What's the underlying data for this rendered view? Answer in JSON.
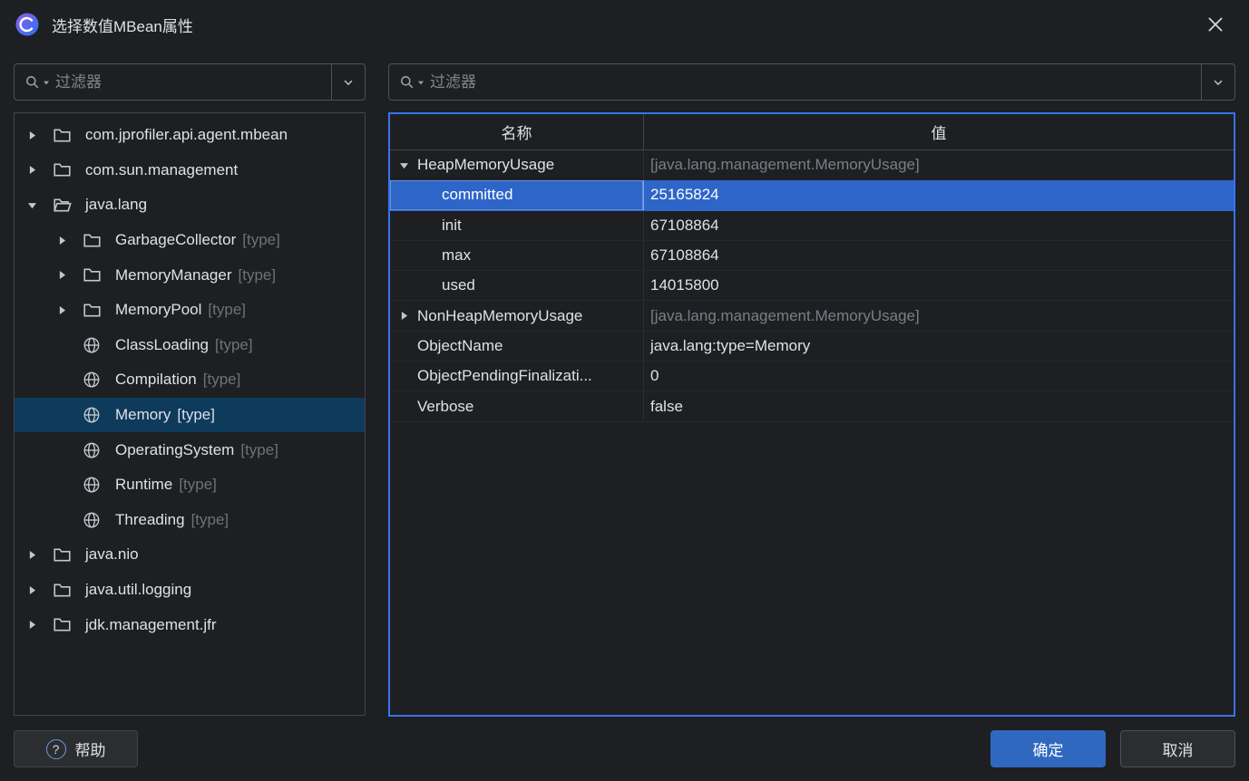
{
  "titlebar": {
    "title": "选择数值MBean属性"
  },
  "left": {
    "filter_placeholder": "过滤器",
    "tree": [
      {
        "label": "com.jprofiler.api.agent.mbean",
        "suffix": "",
        "icon": "folder",
        "expand": "collapsed",
        "level": 0,
        "selected": false
      },
      {
        "label": "com.sun.management",
        "suffix": "",
        "icon": "folder",
        "expand": "collapsed",
        "level": 0,
        "selected": false
      },
      {
        "label": "java.lang",
        "suffix": "",
        "icon": "folder-open",
        "expand": "expanded",
        "level": 0,
        "selected": false
      },
      {
        "label": "GarbageCollector",
        "suffix": "[type]",
        "icon": "folder",
        "expand": "collapsed",
        "level": 1,
        "selected": false
      },
      {
        "label": "MemoryManager",
        "suffix": "[type]",
        "icon": "folder",
        "expand": "collapsed",
        "level": 1,
        "selected": false
      },
      {
        "label": "MemoryPool",
        "suffix": "[type]",
        "icon": "folder",
        "expand": "collapsed",
        "level": 1,
        "selected": false
      },
      {
        "label": "ClassLoading",
        "suffix": "[type]",
        "icon": "globe",
        "expand": "none",
        "level": 1,
        "selected": false
      },
      {
        "label": "Compilation",
        "suffix": "[type]",
        "icon": "globe",
        "expand": "none",
        "level": 1,
        "selected": false
      },
      {
        "label": "Memory",
        "suffix": "[type]",
        "icon": "globe",
        "expand": "none",
        "level": 1,
        "selected": true
      },
      {
        "label": "OperatingSystem",
        "suffix": "[type]",
        "icon": "globe",
        "expand": "none",
        "level": 1,
        "selected": false
      },
      {
        "label": "Runtime",
        "suffix": "[type]",
        "icon": "globe",
        "expand": "none",
        "level": 1,
        "selected": false
      },
      {
        "label": "Threading",
        "suffix": "[type]",
        "icon": "globe",
        "expand": "none",
        "level": 1,
        "selected": false
      },
      {
        "label": "java.nio",
        "suffix": "",
        "icon": "folder",
        "expand": "collapsed",
        "level": 0,
        "selected": false
      },
      {
        "label": "java.util.logging",
        "suffix": "",
        "icon": "folder",
        "expand": "collapsed",
        "level": 0,
        "selected": false
      },
      {
        "label": "jdk.management.jfr",
        "suffix": "",
        "icon": "folder",
        "expand": "collapsed",
        "level": 0,
        "selected": false
      }
    ]
  },
  "right": {
    "filter_placeholder": "过滤器",
    "table": {
      "columns": [
        "名称",
        "值"
      ],
      "rows": [
        {
          "name": "HeapMemoryUsage",
          "value": "[java.lang.management.MemoryUsage]",
          "expand": "expanded",
          "level": 0,
          "muted": true,
          "selected": false
        },
        {
          "name": "committed",
          "value": "25165824",
          "expand": "none",
          "level": 1,
          "muted": false,
          "selected": true
        },
        {
          "name": "init",
          "value": "67108864",
          "expand": "none",
          "level": 1,
          "muted": false,
          "selected": false
        },
        {
          "name": "max",
          "value": "67108864",
          "expand": "none",
          "level": 1,
          "muted": false,
          "selected": false
        },
        {
          "name": "used",
          "value": "14015800",
          "expand": "none",
          "level": 1,
          "muted": false,
          "selected": false
        },
        {
          "name": "NonHeapMemoryUsage",
          "value": "[java.lang.management.MemoryUsage]",
          "expand": "collapsed",
          "level": 0,
          "muted": true,
          "selected": false
        },
        {
          "name": "ObjectName",
          "value": "java.lang:type=Memory",
          "expand": "none",
          "level": 0,
          "muted": false,
          "selected": false
        },
        {
          "name": "ObjectPendingFinalizati...",
          "value": "0",
          "expand": "none",
          "level": 0,
          "muted": false,
          "selected": false
        },
        {
          "name": "Verbose",
          "value": "false",
          "expand": "none",
          "level": 0,
          "muted": false,
          "selected": false
        }
      ]
    }
  },
  "footer": {
    "help": "帮助",
    "ok": "确定",
    "cancel": "取消"
  },
  "colors": {
    "background": "#1e1f22",
    "table_selection": "#2e65c9",
    "tree_selection": "#0e3a5c",
    "focus_border": "#3574f0",
    "primary_button": "#3068c0",
    "muted_text": "#7a7e85"
  },
  "icons": {
    "logo": "jprofiler-logo-icon",
    "search": "search-icon",
    "dropdown": "chevron-down-icon",
    "close": "close-icon",
    "help": "help-question-icon"
  }
}
